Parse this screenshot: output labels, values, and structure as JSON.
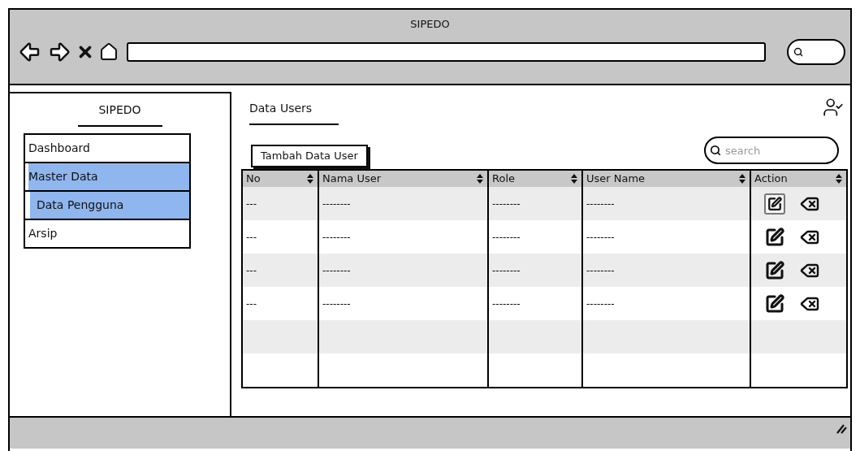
{
  "browser": {
    "title": "SIPEDO"
  },
  "sidebar": {
    "title": "SIPEDO",
    "items": [
      {
        "label": "Dashboard",
        "selected": false
      },
      {
        "label": "Master Data",
        "selected": true,
        "children": [
          {
            "label": "Data Pengguna",
            "selected": true
          }
        ]
      },
      {
        "label": "Arsip",
        "selected": false
      }
    ]
  },
  "main": {
    "title": "Data Users",
    "add_button": "Tambah Data User",
    "search": {
      "placeholder": "search"
    }
  },
  "table": {
    "columns": [
      "No",
      "Nama User",
      "Role",
      "User Name",
      "Action"
    ],
    "rows": [
      {
        "kind": "data",
        "cells": [
          "---",
          "--------",
          "--------",
          "--------"
        ],
        "edit_focused": true
      },
      {
        "kind": "data",
        "cells": [
          "---",
          "--------",
          "--------",
          "--------"
        ],
        "edit_focused": false
      },
      {
        "kind": "data",
        "cells": [
          "---",
          "--------",
          "--------",
          "--------"
        ],
        "edit_focused": false
      },
      {
        "kind": "data",
        "cells": [
          "---",
          "--------",
          "--------",
          "--------"
        ],
        "edit_focused": false
      },
      {
        "kind": "blank"
      },
      {
        "kind": "blank"
      }
    ]
  }
}
